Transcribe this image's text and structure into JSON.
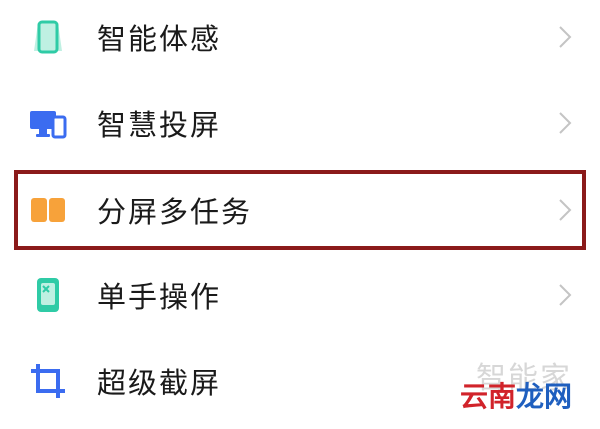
{
  "settings_list": {
    "items": [
      {
        "label": "智能体感",
        "icon": "phone-outline-icon",
        "icon_color": "#2fcba6"
      },
      {
        "label": "智慧投屏",
        "icon": "screen-cast-icon",
        "icon_color": "#3b6cf0"
      },
      {
        "label": "分屏多任务",
        "icon": "split-screen-icon",
        "icon_color": "#f7a23a"
      },
      {
        "label": "单手操作",
        "icon": "one-hand-icon",
        "icon_color": "#2fcba6"
      },
      {
        "label": "超级截屏",
        "icon": "crop-icon",
        "icon_color": "#3b6cf0"
      }
    ],
    "highlighted_item": "分屏多任务",
    "highlight_color": "#8b1a1a"
  },
  "watermark": {
    "top_text": "智能家",
    "bottom_text_part1": "云南",
    "bottom_text_part2": "龙网"
  }
}
